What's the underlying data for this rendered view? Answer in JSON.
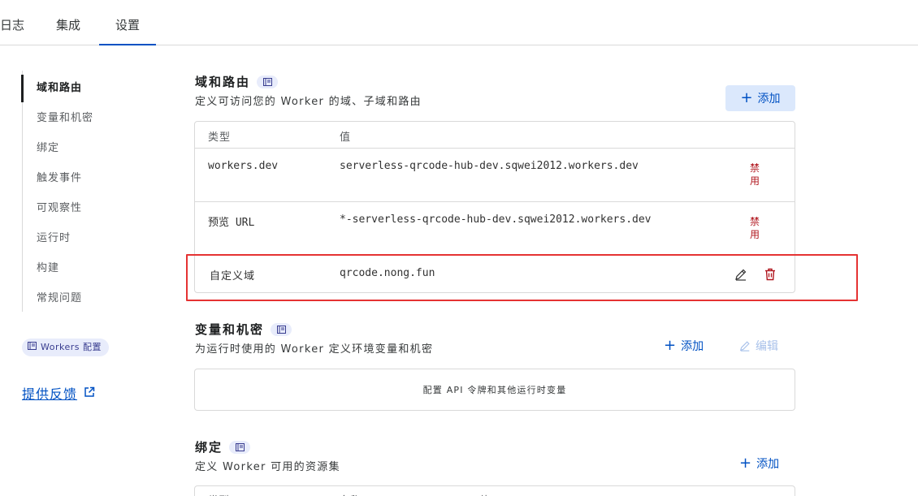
{
  "tabs": [
    {
      "label": "日志"
    },
    {
      "label": "集成"
    },
    {
      "label": "设置",
      "active": true
    }
  ],
  "sidebar": {
    "items": [
      {
        "label": "域和路由",
        "active": true
      },
      {
        "label": "变量和机密"
      },
      {
        "label": "绑定"
      },
      {
        "label": "触发事件"
      },
      {
        "label": "可观察性"
      },
      {
        "label": "运行时"
      },
      {
        "label": "构建"
      },
      {
        "label": "常规问题"
      }
    ],
    "workers_badge": "Workers 配置",
    "feedback": "提供反馈"
  },
  "domains": {
    "title": "域和路由",
    "description": "定义可访问您的 Worker 的域、子域和路由",
    "add_label": "添加",
    "columns": [
      "类型",
      "值"
    ],
    "rows": [
      {
        "type": "workers.dev",
        "value": "serverless-qrcode-hub-dev.sqwei2012.workers.dev",
        "action": "禁用"
      },
      {
        "type": "预览 URL",
        "value": "*-serverless-qrcode-hub-dev.sqwei2012.workers.dev",
        "action": "禁用"
      },
      {
        "type": "自定义域",
        "value": "qrcode.nong.fun"
      }
    ]
  },
  "variables": {
    "title": "变量和机密",
    "description": "为运行时使用的 Worker 定义环境变量和机密",
    "add_label": "添加",
    "edit_label": "编辑",
    "empty_text": "配置 API 令牌和其他运行时变量"
  },
  "bindings": {
    "title": "绑定",
    "description": "定义 Worker 可用的资源集",
    "add_label": "添加",
    "columns": [
      "类型",
      "名称",
      "值"
    ]
  },
  "colors": {
    "accent": "#0051c3",
    "danger": "#b0151d",
    "highlight": "#e53333"
  }
}
